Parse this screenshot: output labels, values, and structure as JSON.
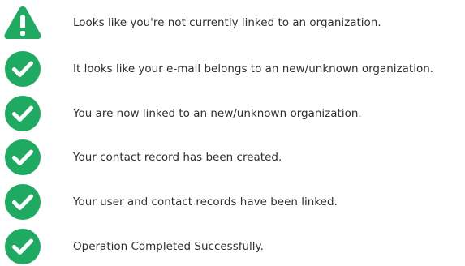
{
  "colors": {
    "success": "#1faa62",
    "warning": "#1faa62",
    "text": "#2f2f2f"
  },
  "status_messages": [
    {
      "icon": "warning-triangle-icon",
      "text": "Looks like you're not currently linked to an organization."
    },
    {
      "icon": "check-circle-icon",
      "text": "It looks like your e-mail belongs to an new/unknown organization."
    },
    {
      "icon": "check-circle-icon",
      "text": "You are now linked to an new/unknown organization."
    },
    {
      "icon": "check-circle-icon",
      "text": "Your contact record has been created."
    },
    {
      "icon": "check-circle-icon",
      "text": "Your user and contact records have been linked."
    },
    {
      "icon": "check-circle-icon",
      "text": "Operation Completed Successfully."
    }
  ]
}
